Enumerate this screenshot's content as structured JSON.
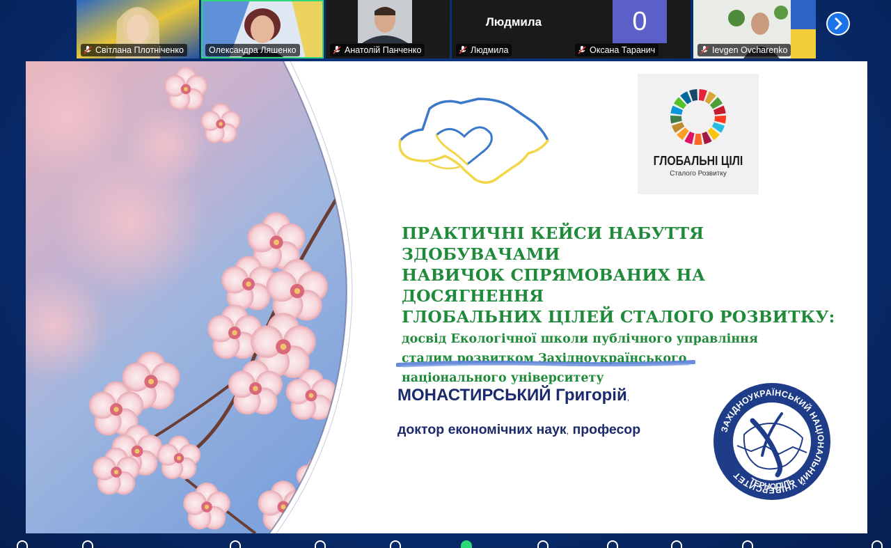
{
  "participants": [
    {
      "name": "Світлана Плотніченко",
      "muted": true
    },
    {
      "name": "Олександра Ляшенко",
      "muted": false,
      "speaking": true
    },
    {
      "name": "Анатолій Панченко",
      "muted": true
    },
    {
      "name": "Людмила",
      "muted": true,
      "display_label": "Людмила"
    },
    {
      "name": "Оксана Таранич",
      "muted": true,
      "avatar_text": "0"
    },
    {
      "name": "Ievgen Ovcharenko",
      "muted": true
    }
  ],
  "slide": {
    "title_lines": [
      "ПРАКТИЧНІ КЕЙСИ НАБУТТЯ ЗДОБУВАЧАМИ",
      "НАВИЧОК СПРЯМОВАНИХ НА ДОСЯГНЕННЯ",
      "ГЛОБАЛЬНИХ ЦІЛЕЙ СТАЛОГО РОЗВИТКУ:"
    ],
    "subtitle_lines": [
      "досвід Екологічної школи публічного управління",
      "сталим розвитком Західноукраїнського",
      "національного університету"
    ],
    "author_name": "МОНАСТИРСЬКИЙ Григорій",
    "author_name_suffix": ",",
    "author_degree": "доктор економічних наук",
    "author_degree_sep": ",",
    "author_rank": "професор",
    "sdg_logo": {
      "title": "ГЛОБАЛЬНІ ЦІЛІ",
      "subtitle": "Сталого Розвитку"
    },
    "university_logo": {
      "ring_text": "ЗАХІДНОУКРАЇНСЬКИЙ НАЦІОНАЛЬНИЙ УНІВЕРСИТЕТ",
      "city": "ТЕРНОПІЛЬ"
    }
  },
  "colors": {
    "title_green": "#1f8b3a",
    "author_navy": "#1b2a6b",
    "ukraine_blue": "#3a78c9",
    "ukraine_yellow": "#f2d64a",
    "background": "#082d70",
    "speaking_outline": "#2ed87a"
  },
  "icons": [
    "mic-off-icon",
    "chevron-right-icon",
    "sdg-wheel-icon",
    "ukraine-heart-map-icon",
    "university-seal-icon"
  ]
}
